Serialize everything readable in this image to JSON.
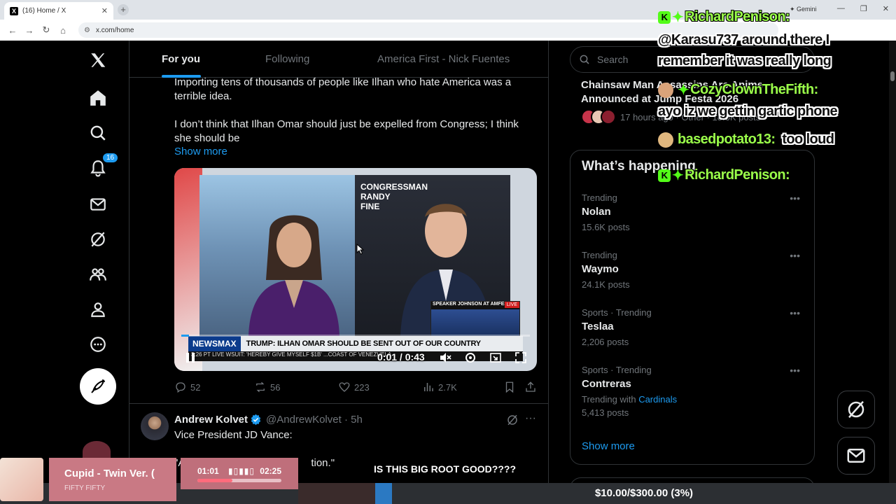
{
  "browser": {
    "tab_title": "(16) Home / X",
    "tab_logo": "X",
    "url": "x.com/home",
    "gemini_label": "Gemini"
  },
  "nav": {
    "notifications_badge": "16"
  },
  "feed": {
    "tabs": [
      "For you",
      "Following",
      "America First - Nick Fuentes"
    ],
    "post1": {
      "text_lines": [
        "Importing tens of thousands of people like Ilhan who hate America was a",
        "terrible idea.",
        "I don’t think that Ilhan Omar should just be expelled from Congress; I think",
        "she should be"
      ],
      "show_more": "Show more",
      "video": {
        "network": "NEWSMAX",
        "headline": "TRUMP: ILHAN OMAR SHOULD BE SENT OUT OF OUR COUNTRY",
        "ticker": "3:26 PT   LIVE   WSUIT: 'HEREBY GIVE MYSELF $1B'   ...COAST OF VENEZUELA",
        "speaker_label": "SPEAKER JOHNSON AT AMFEST",
        "live": "LIVE",
        "backdrop": "CONGRESSMAN RANDY FINE",
        "time": "0:01 / 0:43",
        "progress_fraction": 0.023
      },
      "replies": "52",
      "reposts": "56",
      "likes": "223",
      "views": "2.7K"
    },
    "post2": {
      "author": "Andrew Kolvet",
      "handle": "@AndrewKolvet · 5h",
      "text": "Vice President JD Vance:",
      "text2_start": "\"A",
      "text2_end": "tion.\""
    }
  },
  "sidebar": {
    "search_placeholder": "Search",
    "news": {
      "title": "Chainsaw Man Assassins Arc Anime Announced at Jump Festa 2026",
      "meta": "17 hours ago · Other · 18.6K posts"
    },
    "happening_title": "What’s happening",
    "trends": [
      {
        "context": "Trending",
        "name": "Nolan",
        "posts": "15.6K posts"
      },
      {
        "context": "Trending",
        "name": "Waymo",
        "posts": "24.1K posts"
      },
      {
        "context": "Sports · Trending",
        "name": "Teslaa",
        "posts": "2,206 posts"
      },
      {
        "context": "Sports · Trending",
        "name": "Contreras",
        "with_label": "Trending with",
        "with_link": "Cardinals",
        "posts": "5,413 posts"
      }
    ],
    "show_more": "Show more"
  },
  "overlay": {
    "chat": [
      {
        "user": "RichardPenison:",
        "message": "@Karasu737 around there I",
        "message2": "remember it was really long"
      },
      {
        "user": "CozyClownTheFifth:",
        "message": "ayo iz we gettin gartic phone"
      },
      {
        "user": "basedpotato13:",
        "message": "too loud"
      },
      {
        "user": "RichardPenison:",
        "message": ""
      }
    ],
    "player": {
      "title": "Cupid - Twin Ver. (",
      "artist": "FIFTY FIFTY",
      "current": "01:01",
      "total": "02:25",
      "progress_fraction": 0.42
    },
    "caption": "IS THIS BIG ROOT GOOD????",
    "goal": "$10.00/$300.00 (3%)"
  }
}
